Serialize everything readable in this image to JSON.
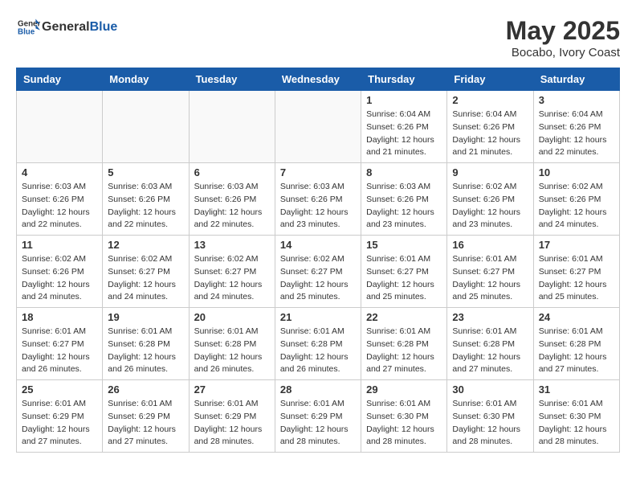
{
  "header": {
    "logo_general": "General",
    "logo_blue": "Blue",
    "title": "May 2025",
    "subtitle": "Bocabo, Ivory Coast"
  },
  "days_of_week": [
    "Sunday",
    "Monday",
    "Tuesday",
    "Wednesday",
    "Thursday",
    "Friday",
    "Saturday"
  ],
  "weeks": [
    [
      {
        "day": "",
        "info": ""
      },
      {
        "day": "",
        "info": ""
      },
      {
        "day": "",
        "info": ""
      },
      {
        "day": "",
        "info": ""
      },
      {
        "day": "1",
        "info": "Sunrise: 6:04 AM\nSunset: 6:26 PM\nDaylight: 12 hours\nand 21 minutes."
      },
      {
        "day": "2",
        "info": "Sunrise: 6:04 AM\nSunset: 6:26 PM\nDaylight: 12 hours\nand 21 minutes."
      },
      {
        "day": "3",
        "info": "Sunrise: 6:04 AM\nSunset: 6:26 PM\nDaylight: 12 hours\nand 22 minutes."
      }
    ],
    [
      {
        "day": "4",
        "info": "Sunrise: 6:03 AM\nSunset: 6:26 PM\nDaylight: 12 hours\nand 22 minutes."
      },
      {
        "day": "5",
        "info": "Sunrise: 6:03 AM\nSunset: 6:26 PM\nDaylight: 12 hours\nand 22 minutes."
      },
      {
        "day": "6",
        "info": "Sunrise: 6:03 AM\nSunset: 6:26 PM\nDaylight: 12 hours\nand 22 minutes."
      },
      {
        "day": "7",
        "info": "Sunrise: 6:03 AM\nSunset: 6:26 PM\nDaylight: 12 hours\nand 23 minutes."
      },
      {
        "day": "8",
        "info": "Sunrise: 6:03 AM\nSunset: 6:26 PM\nDaylight: 12 hours\nand 23 minutes."
      },
      {
        "day": "9",
        "info": "Sunrise: 6:02 AM\nSunset: 6:26 PM\nDaylight: 12 hours\nand 23 minutes."
      },
      {
        "day": "10",
        "info": "Sunrise: 6:02 AM\nSunset: 6:26 PM\nDaylight: 12 hours\nand 24 minutes."
      }
    ],
    [
      {
        "day": "11",
        "info": "Sunrise: 6:02 AM\nSunset: 6:26 PM\nDaylight: 12 hours\nand 24 minutes."
      },
      {
        "day": "12",
        "info": "Sunrise: 6:02 AM\nSunset: 6:27 PM\nDaylight: 12 hours\nand 24 minutes."
      },
      {
        "day": "13",
        "info": "Sunrise: 6:02 AM\nSunset: 6:27 PM\nDaylight: 12 hours\nand 24 minutes."
      },
      {
        "day": "14",
        "info": "Sunrise: 6:02 AM\nSunset: 6:27 PM\nDaylight: 12 hours\nand 25 minutes."
      },
      {
        "day": "15",
        "info": "Sunrise: 6:01 AM\nSunset: 6:27 PM\nDaylight: 12 hours\nand 25 minutes."
      },
      {
        "day": "16",
        "info": "Sunrise: 6:01 AM\nSunset: 6:27 PM\nDaylight: 12 hours\nand 25 minutes."
      },
      {
        "day": "17",
        "info": "Sunrise: 6:01 AM\nSunset: 6:27 PM\nDaylight: 12 hours\nand 25 minutes."
      }
    ],
    [
      {
        "day": "18",
        "info": "Sunrise: 6:01 AM\nSunset: 6:27 PM\nDaylight: 12 hours\nand 26 minutes."
      },
      {
        "day": "19",
        "info": "Sunrise: 6:01 AM\nSunset: 6:28 PM\nDaylight: 12 hours\nand 26 minutes."
      },
      {
        "day": "20",
        "info": "Sunrise: 6:01 AM\nSunset: 6:28 PM\nDaylight: 12 hours\nand 26 minutes."
      },
      {
        "day": "21",
        "info": "Sunrise: 6:01 AM\nSunset: 6:28 PM\nDaylight: 12 hours\nand 26 minutes."
      },
      {
        "day": "22",
        "info": "Sunrise: 6:01 AM\nSunset: 6:28 PM\nDaylight: 12 hours\nand 27 minutes."
      },
      {
        "day": "23",
        "info": "Sunrise: 6:01 AM\nSunset: 6:28 PM\nDaylight: 12 hours\nand 27 minutes."
      },
      {
        "day": "24",
        "info": "Sunrise: 6:01 AM\nSunset: 6:28 PM\nDaylight: 12 hours\nand 27 minutes."
      }
    ],
    [
      {
        "day": "25",
        "info": "Sunrise: 6:01 AM\nSunset: 6:29 PM\nDaylight: 12 hours\nand 27 minutes."
      },
      {
        "day": "26",
        "info": "Sunrise: 6:01 AM\nSunset: 6:29 PM\nDaylight: 12 hours\nand 27 minutes."
      },
      {
        "day": "27",
        "info": "Sunrise: 6:01 AM\nSunset: 6:29 PM\nDaylight: 12 hours\nand 28 minutes."
      },
      {
        "day": "28",
        "info": "Sunrise: 6:01 AM\nSunset: 6:29 PM\nDaylight: 12 hours\nand 28 minutes."
      },
      {
        "day": "29",
        "info": "Sunrise: 6:01 AM\nSunset: 6:30 PM\nDaylight: 12 hours\nand 28 minutes."
      },
      {
        "day": "30",
        "info": "Sunrise: 6:01 AM\nSunset: 6:30 PM\nDaylight: 12 hours\nand 28 minutes."
      },
      {
        "day": "31",
        "info": "Sunrise: 6:01 AM\nSunset: 6:30 PM\nDaylight: 12 hours\nand 28 minutes."
      }
    ]
  ]
}
